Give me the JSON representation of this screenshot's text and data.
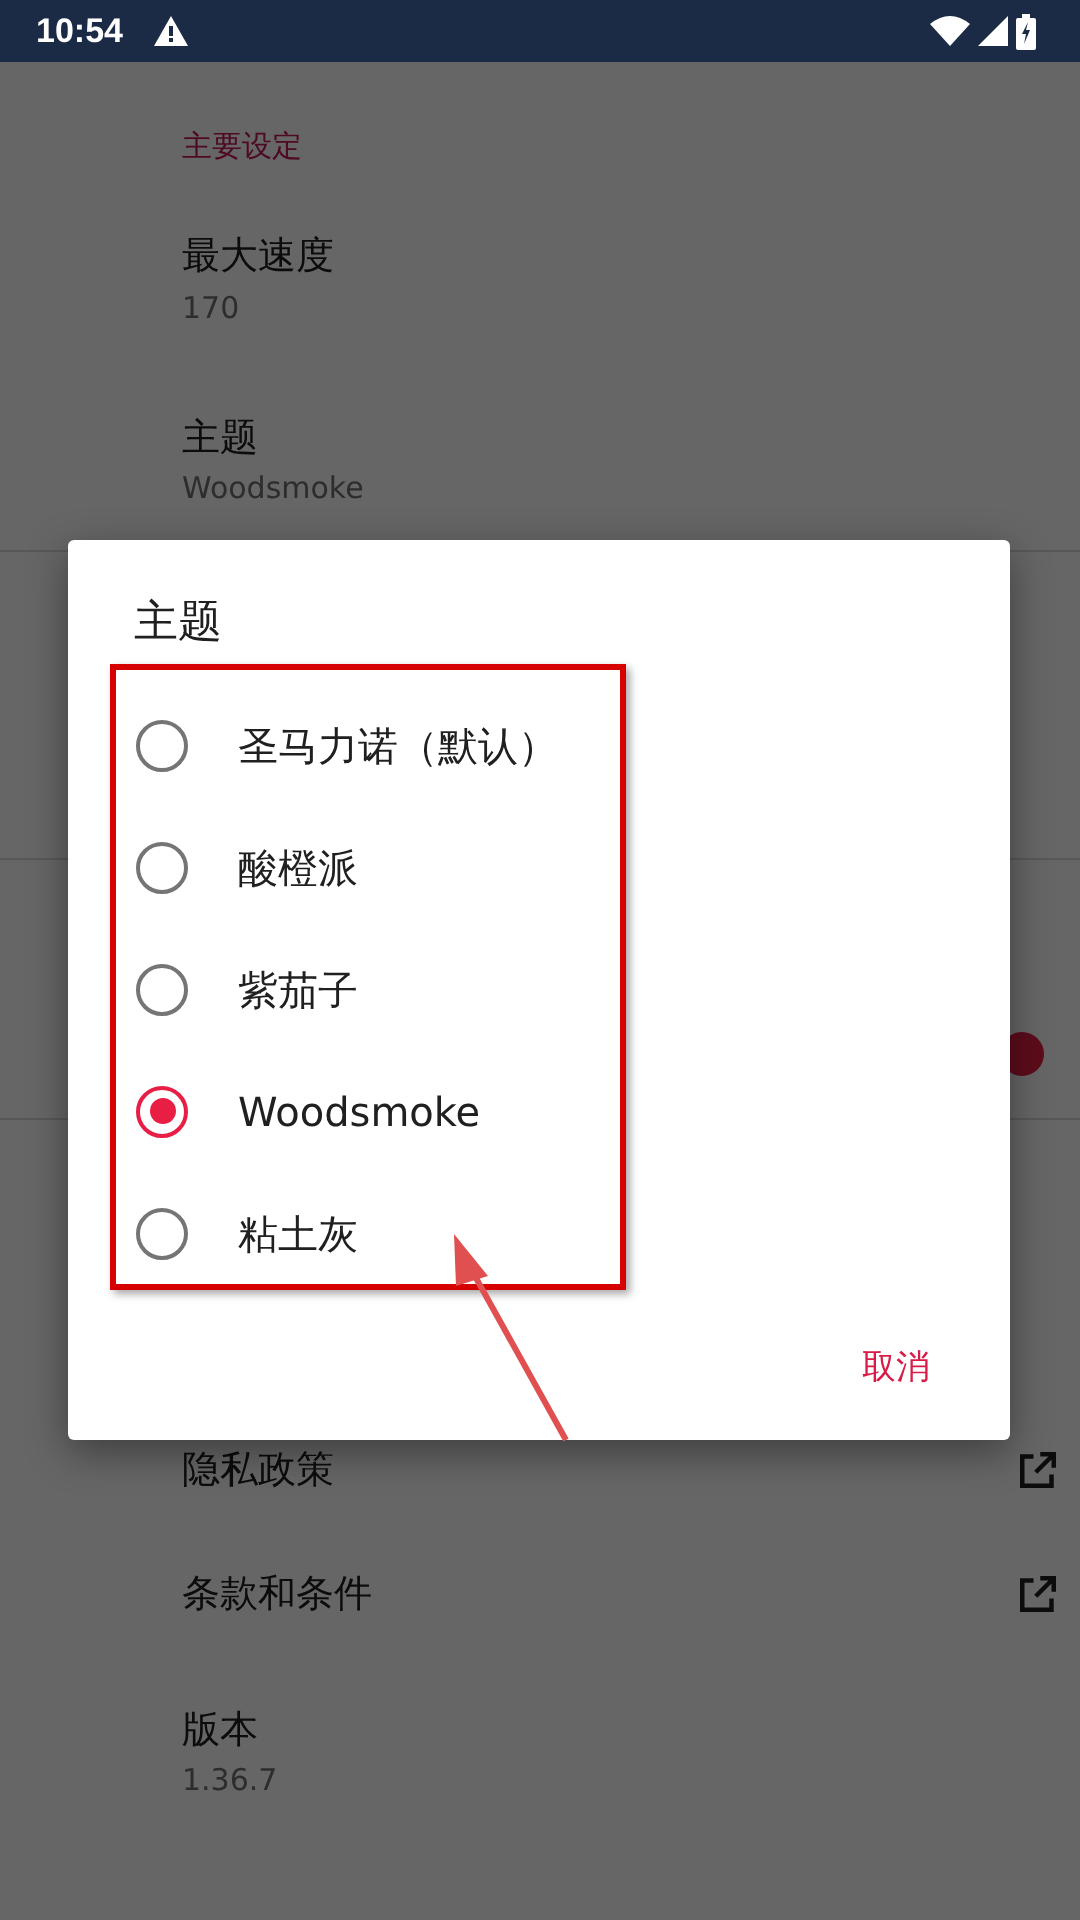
{
  "status_bar": {
    "time": "10:54"
  },
  "settings": {
    "section_header": "主要设定",
    "items": [
      {
        "kind": "value",
        "title": "最大速度",
        "value": "170"
      },
      {
        "kind": "value",
        "title": "主题",
        "value": "Woodsmoke"
      }
    ],
    "toggle": {
      "on": true
    },
    "links": [
      {
        "kind": "link",
        "title": "隐私政策"
      },
      {
        "kind": "link",
        "title": "条款和条件"
      },
      {
        "kind": "value",
        "title": "版本",
        "value": "1.36.7"
      }
    ]
  },
  "dialog": {
    "title": "主题",
    "options": [
      {
        "label": "圣马力诺（默认）",
        "selected": false
      },
      {
        "label": "酸橙派",
        "selected": false
      },
      {
        "label": "紫茄子",
        "selected": false
      },
      {
        "label": "Woodsmoke",
        "selected": true
      },
      {
        "label": "粘土灰",
        "selected": false
      }
    ],
    "cancel": "取消"
  }
}
